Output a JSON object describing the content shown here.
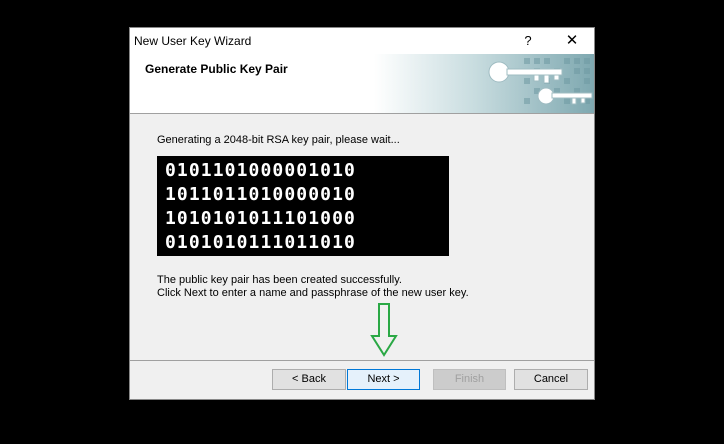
{
  "window": {
    "title": "New User Key Wizard",
    "help_label": "?",
    "close_label": "✕"
  },
  "header": {
    "title": "Generate Public Key Pair"
  },
  "content": {
    "status": "Generating a 2048-bit RSA key pair, please wait...",
    "binary_lines": [
      "0101101000001010",
      "1011011010000010",
      "1010101011101000",
      "0101010111011010"
    ],
    "message_line1": "The public key pair has been created successfully.",
    "message_line2": "Click Next to enter a name and passphrase of the new user key."
  },
  "buttons": {
    "back": "< Back",
    "next": "Next >",
    "finish": "Finish",
    "cancel": "Cancel"
  },
  "colors": {
    "arrow": "#2aa845",
    "default_button_border": "#0078d7"
  },
  "icons": {
    "banner": "keys-banner-icon",
    "arrow": "down-arrow-icon"
  }
}
